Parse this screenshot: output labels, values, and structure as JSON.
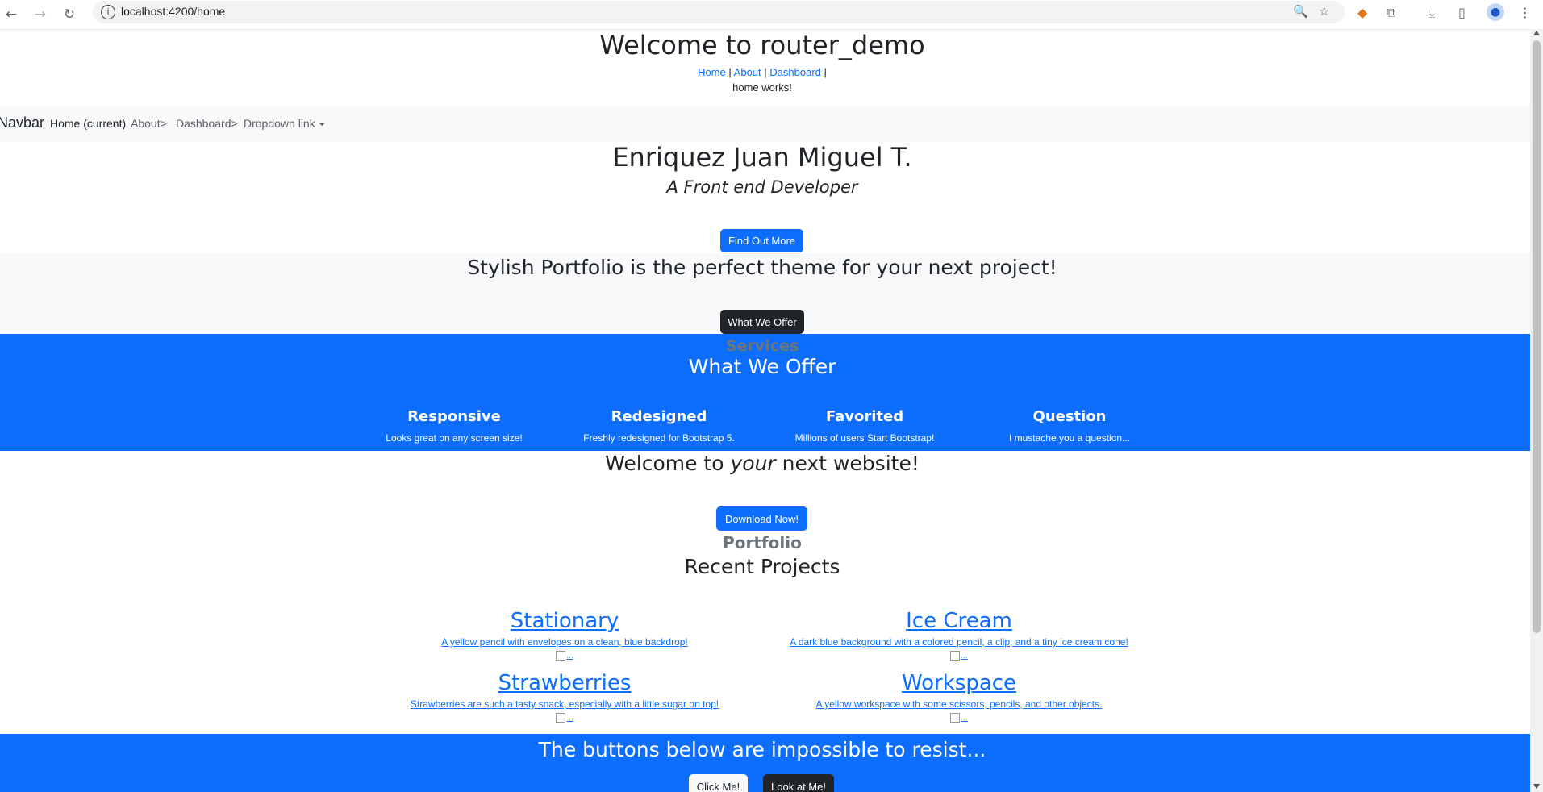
{
  "browser": {
    "url": "localhost:4200/home",
    "icons": [
      "back-icon",
      "forward-icon",
      "reload-icon",
      "info-icon",
      "zoom-icon",
      "star-icon",
      "metamask-icon",
      "extensions-icon",
      "download-icon",
      "sidepanel-icon",
      "profile-icon",
      "menu-icon"
    ]
  },
  "app": {
    "title": "Welcome to router_demo",
    "links": [
      "Home",
      "About",
      "Dashboard"
    ],
    "separator": "|",
    "home_works": "home works!"
  },
  "navbar": {
    "brand": "Navbar",
    "items": [
      "Home (current)",
      "About>",
      "Dashboard>",
      "Dropdown link"
    ]
  },
  "hero": {
    "name": "Enriquez Juan Miguel T.",
    "subtitle": "A Front end Developer",
    "button": "Find Out More"
  },
  "about": {
    "title": "Stylish Portfolio is the perfect theme for your next project!",
    "button": "What We Offer"
  },
  "services": {
    "kicker": "Services",
    "title": "What We Offer",
    "items": [
      {
        "title": "Responsive",
        "text": "Looks great on any screen size!"
      },
      {
        "title": "Redesigned",
        "text": "Freshly redesigned for Bootstrap 5."
      },
      {
        "title": "Favorited",
        "text": "Millions of users Start Bootstrap!"
      },
      {
        "title": "Question",
        "text": "I mustache you a question..."
      }
    ]
  },
  "cta": {
    "title_pre": "Welcome to ",
    "title_em": "your",
    "title_post": " next website!",
    "button": "Download Now!"
  },
  "portfolio": {
    "kicker": "Portfolio",
    "title": "Recent Projects",
    "img_alt": "...",
    "projects": [
      {
        "title": "Stationary",
        "desc": "A yellow pencil with envelopes on a clean, blue backdrop!"
      },
      {
        "title": "Ice Cream",
        "desc": "A dark blue background with a colored pencil, a clip, and a tiny ice cream cone!"
      },
      {
        "title": "Strawberries",
        "desc": "Strawberries are such a tasty snack, especially with a little sugar on top!"
      },
      {
        "title": "Workspace",
        "desc": "A yellow workspace with some scissors, pencils, and other objects."
      }
    ]
  },
  "footer_cta": {
    "title": "The buttons below are impossible to resist...",
    "button1": "Click Me!",
    "button2": "Look at Me!"
  },
  "colors": {
    "primary": "#0d6efd",
    "dark": "#212529",
    "muted": "#6c757d",
    "light": "#f8f9fa"
  }
}
